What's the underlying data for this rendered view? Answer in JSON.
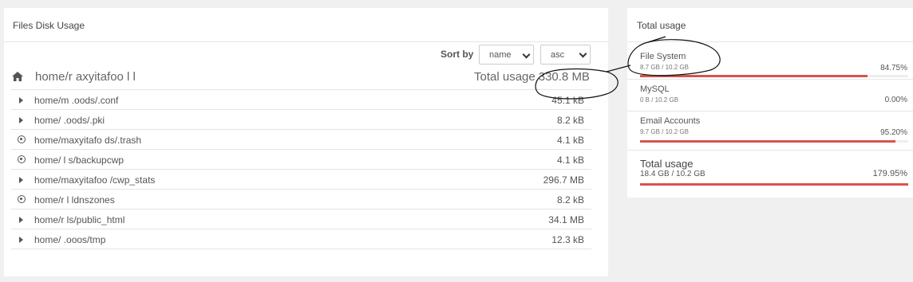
{
  "files_panel": {
    "title": "Files Disk Usage",
    "sort_label": "Sort by",
    "sort_field": "name",
    "sort_dir": "asc",
    "home_path": "home/r        axyitafoo  l  l",
    "total_label": "Total usage",
    "total_value": "330.8 MB",
    "rows": [
      {
        "icon": "caret-right-icon",
        "name": "home/m            .oods/.conf",
        "size": "45.1 kB"
      },
      {
        "icon": "caret-right-icon",
        "name": "home/              .oods/.pki",
        "size": "8.2 kB"
      },
      {
        "icon": "dot-circle-icon",
        "name": "home/maxyitafo  ds/.trash",
        "size": "4.1 kB"
      },
      {
        "icon": "dot-circle-icon",
        "name": "home/              l    s/backupcwp",
        "size": "4.1 kB"
      },
      {
        "icon": "caret-right-icon",
        "name": "home/maxyitafoo  /cwp_stats",
        "size": "296.7 MB"
      },
      {
        "icon": "dot-circle-icon",
        "name": "home/r          l      ldnszones",
        "size": "8.2 kB"
      },
      {
        "icon": "caret-right-icon",
        "name": "home/r            ls/public_html",
        "size": "34.1 MB"
      },
      {
        "icon": "caret-right-icon",
        "name": "home/              .ooos/tmp",
        "size": "12.3 kB"
      }
    ]
  },
  "usage_panel": {
    "title": "Total usage",
    "items": [
      {
        "label": "File System",
        "sub": "8.7 GB / 10.2 GB",
        "percent": "84.75%",
        "fill": 0.8475
      },
      {
        "label": "MySQL",
        "sub": "0 B / 10.2 GB",
        "percent": "0.00%",
        "fill": 0
      },
      {
        "label": "Email Accounts",
        "sub": "9.7 GB / 10.2 GB",
        "percent": "95.20%",
        "fill": 0.952
      }
    ],
    "total": {
      "label": "Total usage",
      "sub": "18.4 GB / 10.2 GB",
      "percent": "179.95%",
      "fill": 1.0
    }
  },
  "colors": {
    "bar": "#d9534f",
    "track": "#eeeeee"
  }
}
